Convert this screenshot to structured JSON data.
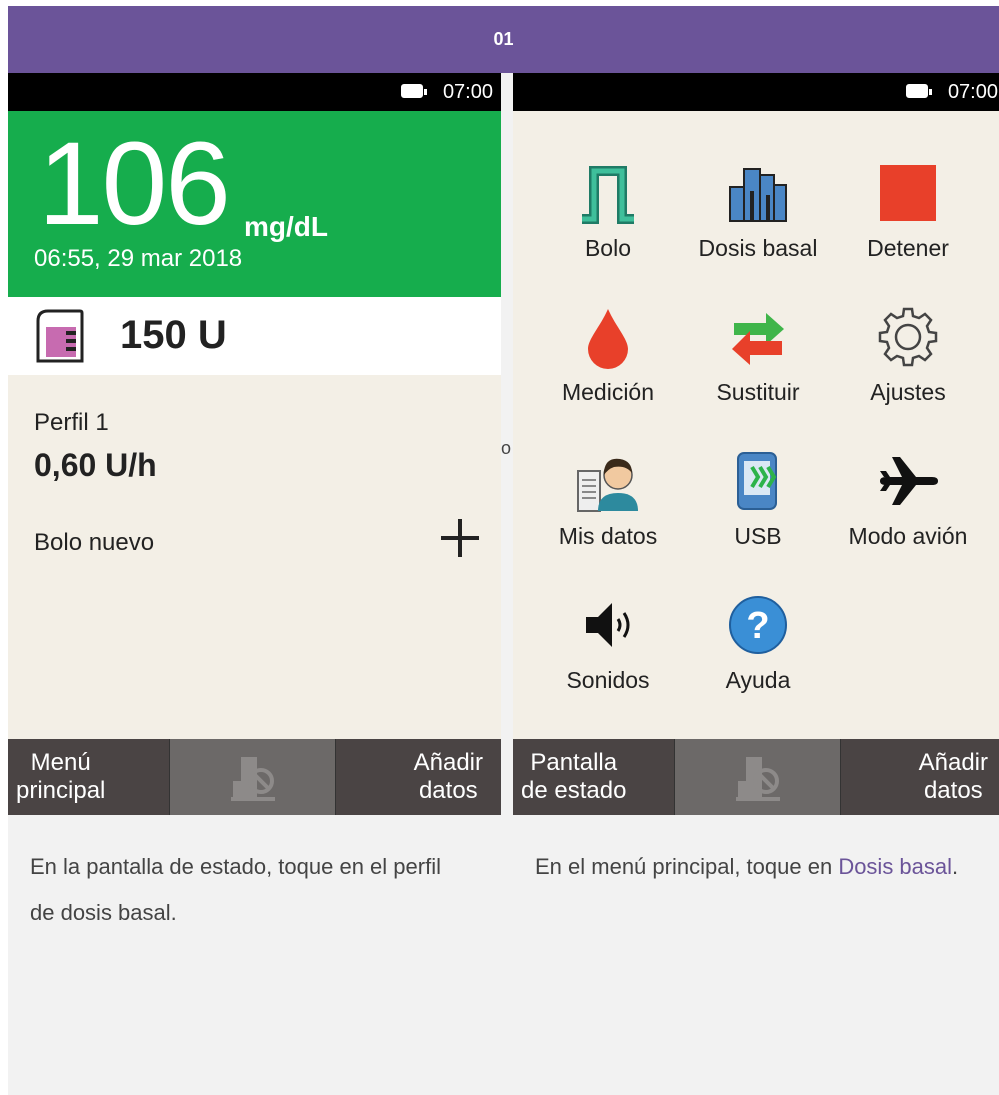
{
  "step": "01",
  "separator": "o",
  "status_time": "07:00",
  "left_screen": {
    "glucose_value": "106",
    "glucose_unit": "mg/dL",
    "timestamp": "06:55, 29 mar 2018",
    "insulin_amount": "150 U",
    "profile_name": "Perfil 1",
    "basal_rate": "0,60 U/h",
    "bolus_label": "Bolo nuevo",
    "bottom_left_line1": "Menú",
    "bottom_left_line2": "principal",
    "bottom_right_line1": "Añadir",
    "bottom_right_line2": "datos"
  },
  "right_screen": {
    "menu": [
      {
        "label": "Bolo",
        "icon": "bolus-icon"
      },
      {
        "label": "Dosis basal",
        "icon": "basal-rate-icon"
      },
      {
        "label": "Detener",
        "icon": "stop-icon"
      },
      {
        "label": "Medición",
        "icon": "blood-drop-icon"
      },
      {
        "label": "Sustituir",
        "icon": "replace-arrows-icon"
      },
      {
        "label": "Ajustes",
        "icon": "gear-icon"
      },
      {
        "label": "Mis datos",
        "icon": "my-data-icon"
      },
      {
        "label": "USB",
        "icon": "usb-icon"
      },
      {
        "label": "Modo avión",
        "icon": "airplane-icon"
      },
      {
        "label": "Sonidos",
        "icon": "speaker-icon"
      },
      {
        "label": "Ayuda",
        "icon": "help-icon"
      }
    ],
    "bottom_left_line1": "Pantalla",
    "bottom_left_line2": "de estado",
    "bottom_right_line1": "Añadir",
    "bottom_right_line2": "datos"
  },
  "captions": {
    "left": "En la pantalla de estado, toque en el perfil de dosis basal.",
    "right_prefix": "En el menú principal, toque en ",
    "right_link": "Dosis basal",
    "right_suffix": "."
  },
  "colors": {
    "step_bar": "#6b5499",
    "glucose_bg": "#16ad4d",
    "screen_bg": "#f3efe6",
    "bottom_bar": "#4a4444",
    "link": "#6b5499"
  }
}
